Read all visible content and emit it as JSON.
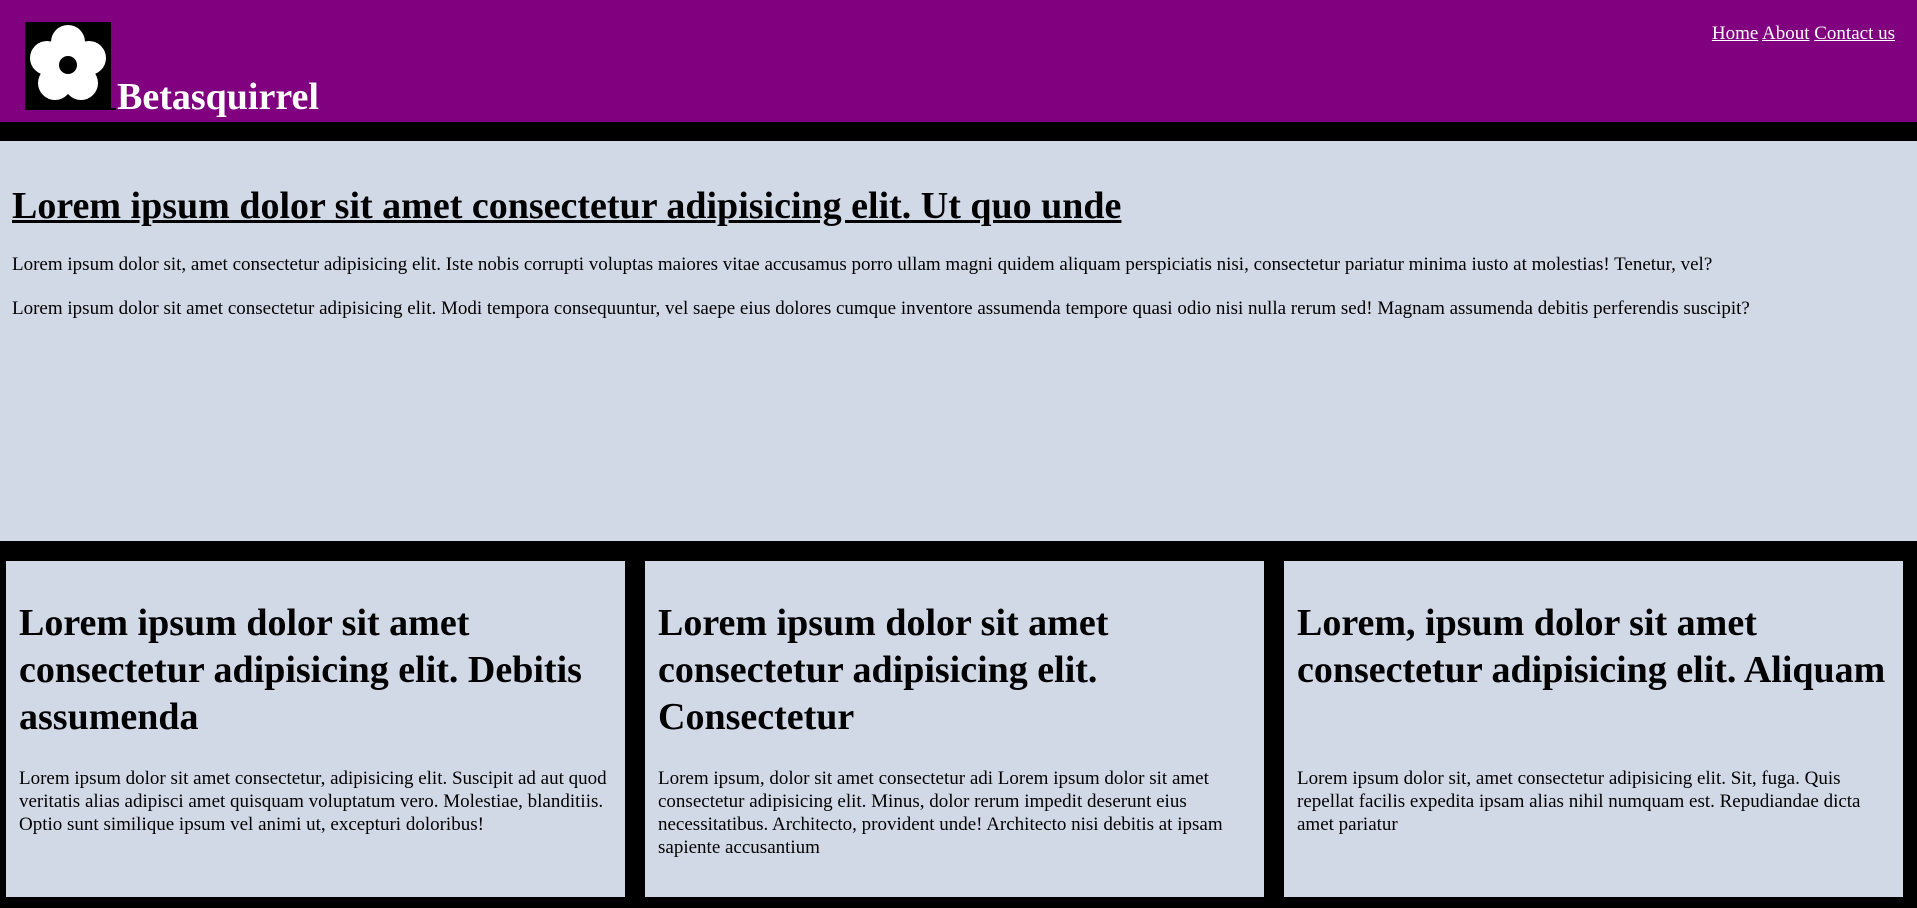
{
  "header": {
    "logo_icon": "flower-icon",
    "brand": "Betasquirrel",
    "bg_color": "#800080",
    "nav": {
      "home": "Home",
      "about": "About",
      "contact": "Contact us"
    }
  },
  "hero": {
    "title": "Lorem ipsum dolor sit amet consectetur adipisicing elit. Ut quo unde",
    "paragraphs": [
      "Lorem ipsum dolor sit, amet consectetur adipisicing elit. Iste nobis corrupti voluptas maiores vitae accusamus porro ullam magni quidem aliquam perspiciatis nisi, consectetur pariatur minima iusto at molestias! Tenetur, vel?",
      "Lorem ipsum dolor sit amet consectetur adipisicing elit. Modi tempora consequuntur, vel saepe eius dolores cumque inventore assumenda tempore quasi odio nisi nulla rerum sed! Magnam assumenda debitis perferendis suscipit?"
    ]
  },
  "cards": [
    {
      "title": "Lorem ipsum dolor sit amet consectetur adipisicing elit. Debitis assumenda",
      "text": "Lorem ipsum dolor sit amet consectetur, adipisicing elit. Suscipit ad aut quod veritatis alias adipisci amet quisquam voluptatum vero. Molestiae, blanditiis. Optio sunt similique ipsum vel animi ut, excepturi doloribus!"
    },
    {
      "title": "Lorem ipsum dolor sit amet consectetur adipisicing elit. Consectetur",
      "text": "Lorem ipsum, dolor sit amet consectetur adi Lorem ipsum dolor sit amet consectetur adipisicing elit. Minus, dolor rerum impedit deserunt eius necessitatibus. Architecto, provident unde! Architecto nisi debitis at ipsam sapiente accusantium"
    },
    {
      "title": "Lorem, ipsum dolor sit amet consectetur adipisicing elit. Aliquam",
      "text": "Lorem ipsum dolor sit, amet consectetur adipisicing elit. Sit, fuga. Quis repellat facilis expedita ipsam alias nihil numquam est. Repudiandae dicta amet pariatur"
    }
  ],
  "colors": {
    "panel_bg": "#d1d8e6",
    "page_bg": "#000000"
  }
}
